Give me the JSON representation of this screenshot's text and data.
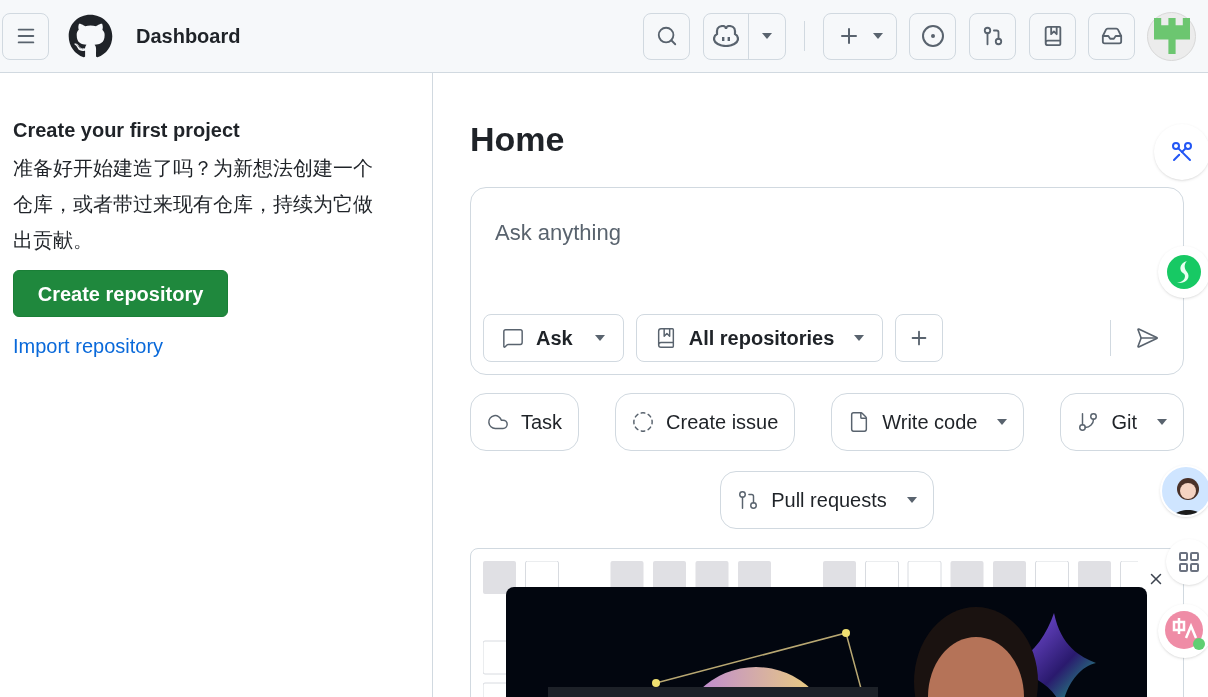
{
  "header": {
    "title": "Dashboard"
  },
  "sidebar": {
    "heading": "Create your first project",
    "text": "准备好开始建造了吗？为新想法创建一个仓库，或者带过来现有仓库，持续为它做出贡献。",
    "primary_button": "Create repository",
    "link": "Import repository"
  },
  "main": {
    "title": "Home",
    "prompt": {
      "placeholder": "Ask anything",
      "mode": "Ask",
      "scope": "All repositories"
    },
    "actions": [
      {
        "label": "Task",
        "kind": "cloud",
        "dropdown": false
      },
      {
        "label": "Create issue",
        "kind": "issue",
        "dropdown": false
      },
      {
        "label": "Write code",
        "kind": "file",
        "dropdown": true
      },
      {
        "label": "Git",
        "kind": "branch",
        "dropdown": true
      },
      {
        "label": "Pull requests",
        "kind": "pull",
        "dropdown": true
      }
    ]
  }
}
